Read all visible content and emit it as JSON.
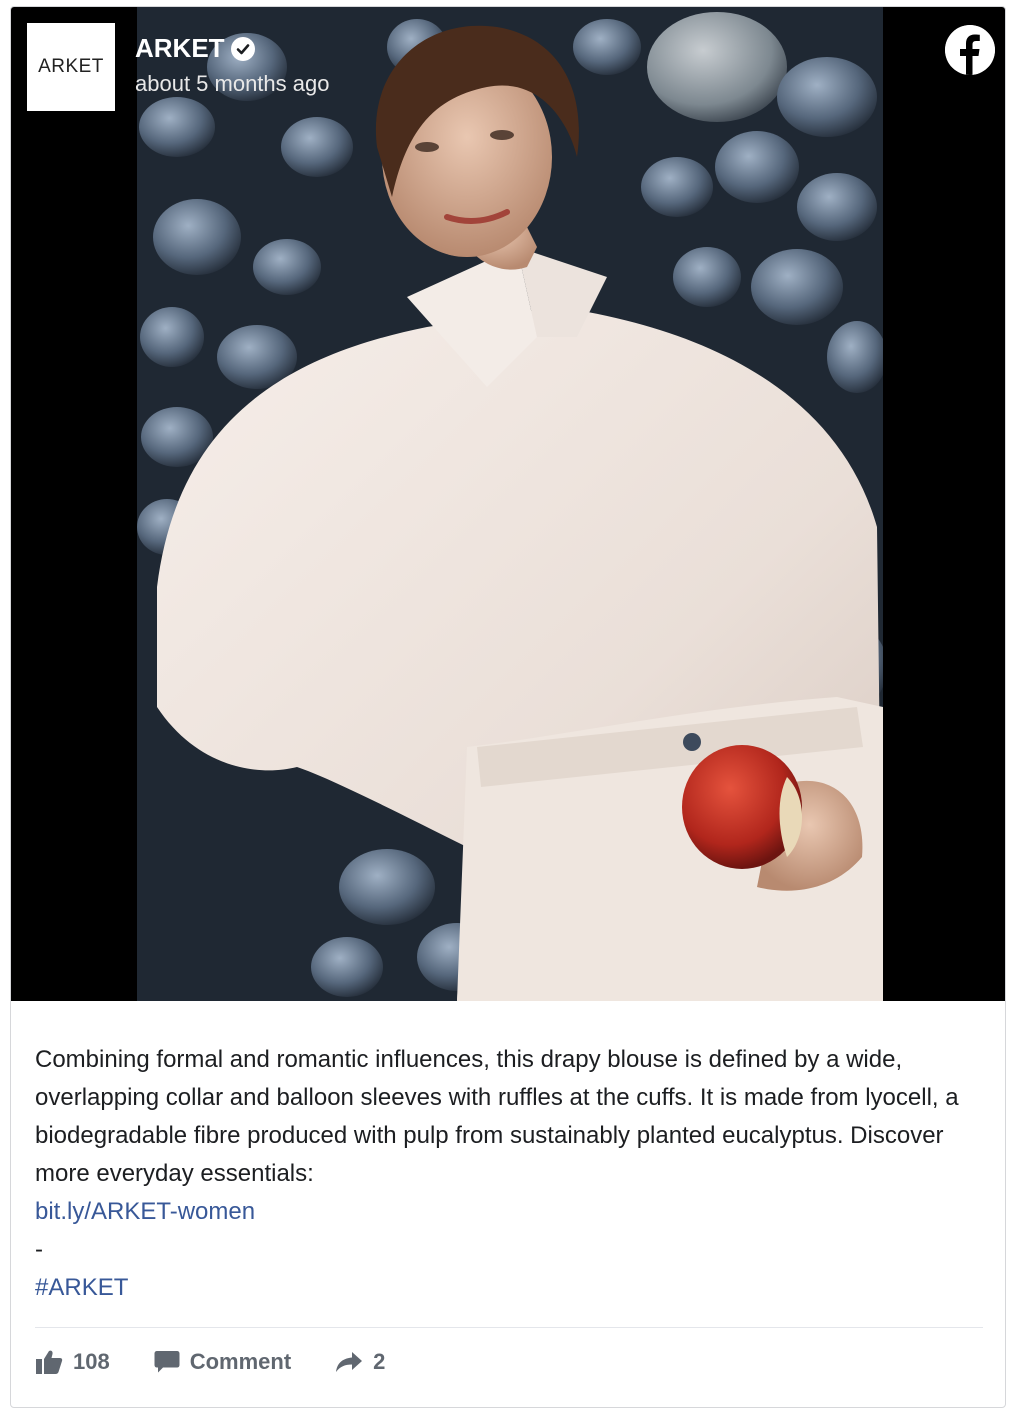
{
  "post": {
    "avatar_text": "ARKET",
    "page_name": "ARKET",
    "verified_icon": "verified-check-icon",
    "timestamp": "about 5 months ago",
    "network_icon": "facebook-icon",
    "body_text": "Combining formal and romantic influences, this drapy blouse is defined by a wide, overlapping collar and balloon sleeves with ruffles at the cuffs. It is made from lyocell, a biodegradable fibre produced with pulp from sustainably planted eucalyptus. Discover more everyday essentials:",
    "link_text": "bit.ly/ARKET-women",
    "separator": "-",
    "hashtag": "#ARKET"
  },
  "actions": {
    "like_count": "108",
    "comment_label": "Comment",
    "share_count": "2"
  },
  "colors": {
    "link": "#385898",
    "text": "#1c1e21",
    "muted": "#606770",
    "media_background": "#000000"
  }
}
